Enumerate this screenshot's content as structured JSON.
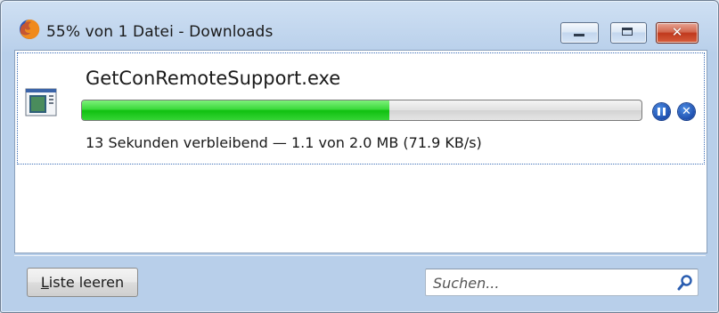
{
  "window": {
    "title": "55% von 1 Datei - Downloads",
    "buttons": {
      "minimize": "minimize-icon",
      "maximize": "maximize-icon",
      "close": "close-icon"
    },
    "close_glyph": "✕"
  },
  "download": {
    "file_name": "GetConRemoteSupport.exe",
    "progress_fraction": 0.55,
    "status": "13 Sekunden verbleibend — 1.1 von 2.0 MB (71.9 KB/s)",
    "controls": {
      "pause": "pause-icon",
      "cancel": "cancel-icon"
    }
  },
  "footer": {
    "clear_prefix": "L",
    "clear_rest": "iste leeren",
    "search_placeholder": "Suchen..."
  },
  "colors": {
    "progress_green": "#10c010",
    "accent_blue": "#1e4fae",
    "close_red": "#c0391d"
  }
}
